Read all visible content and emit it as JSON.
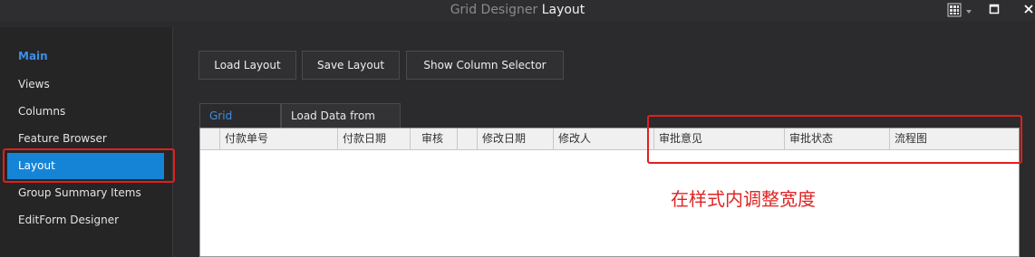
{
  "window": {
    "app_name": "Grid Designer",
    "section_title": "Layout",
    "icons": [
      "palette-icon",
      "chevron-down-icon",
      "maximize-icon",
      "close-icon"
    ]
  },
  "sidebar": {
    "heading": "Main",
    "items": [
      {
        "label": "Views"
      },
      {
        "label": "Columns"
      },
      {
        "label": "Feature Browser"
      },
      {
        "label": "Layout",
        "selected": true
      },
      {
        "label": "Group Summary Items"
      },
      {
        "label": "EditForm Designer"
      }
    ]
  },
  "toolbar": {
    "load_layout": "Load Layout",
    "save_layout": "Save Layout",
    "show_column_selector": "Show Column Selector"
  },
  "tabs": [
    {
      "label": "Grid Preview",
      "active": true
    },
    {
      "label": "Load Data from XML",
      "active": false
    }
  ],
  "grid": {
    "columns": [
      "",
      "付款单号",
      "付款日期",
      "审核",
      "",
      "修改日期",
      "修改人",
      "审批意见",
      "审批状态",
      "流程图"
    ]
  },
  "annotation": {
    "text": "在样式内调整宽度",
    "color": "#e02424"
  },
  "colors": {
    "accent": "#1684d6",
    "highlight": "#e21f1f",
    "background": "#2b2b2d"
  }
}
